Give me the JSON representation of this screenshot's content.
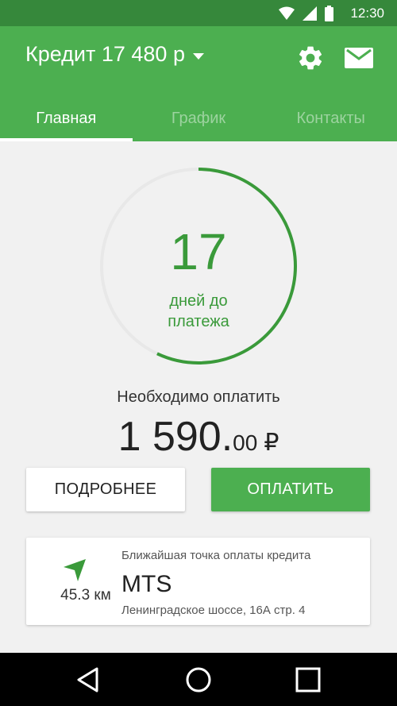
{
  "status_bar": {
    "time": "12:30"
  },
  "header": {
    "title": "Кредит 17 480 р",
    "icons": [
      "settings-icon",
      "mail-icon"
    ]
  },
  "tabs": [
    {
      "label": "Главная",
      "active": true
    },
    {
      "label": "График",
      "active": false
    },
    {
      "label": "Контакты",
      "active": false
    }
  ],
  "countdown": {
    "days": "17",
    "label": "дней до платежа",
    "progress": 0.57
  },
  "payment": {
    "label": "Необходимо оплатить",
    "amount_main": "1 590.",
    "amount_cents": "00",
    "currency": "₽"
  },
  "buttons": {
    "details": "ПОДРОБНЕЕ",
    "pay": "ОПЛАТИТЬ"
  },
  "nearest_point": {
    "caption": "Ближайшая точка оплаты кредита",
    "distance": "45.3 км",
    "name": "MTS",
    "address": "Ленинградское шоссе, 16А стр. 4"
  },
  "colors": {
    "primary": "#4caf50",
    "primary_dark": "#36883b",
    "accent_text": "#3a9a3a",
    "track": "#e8e8e8"
  }
}
